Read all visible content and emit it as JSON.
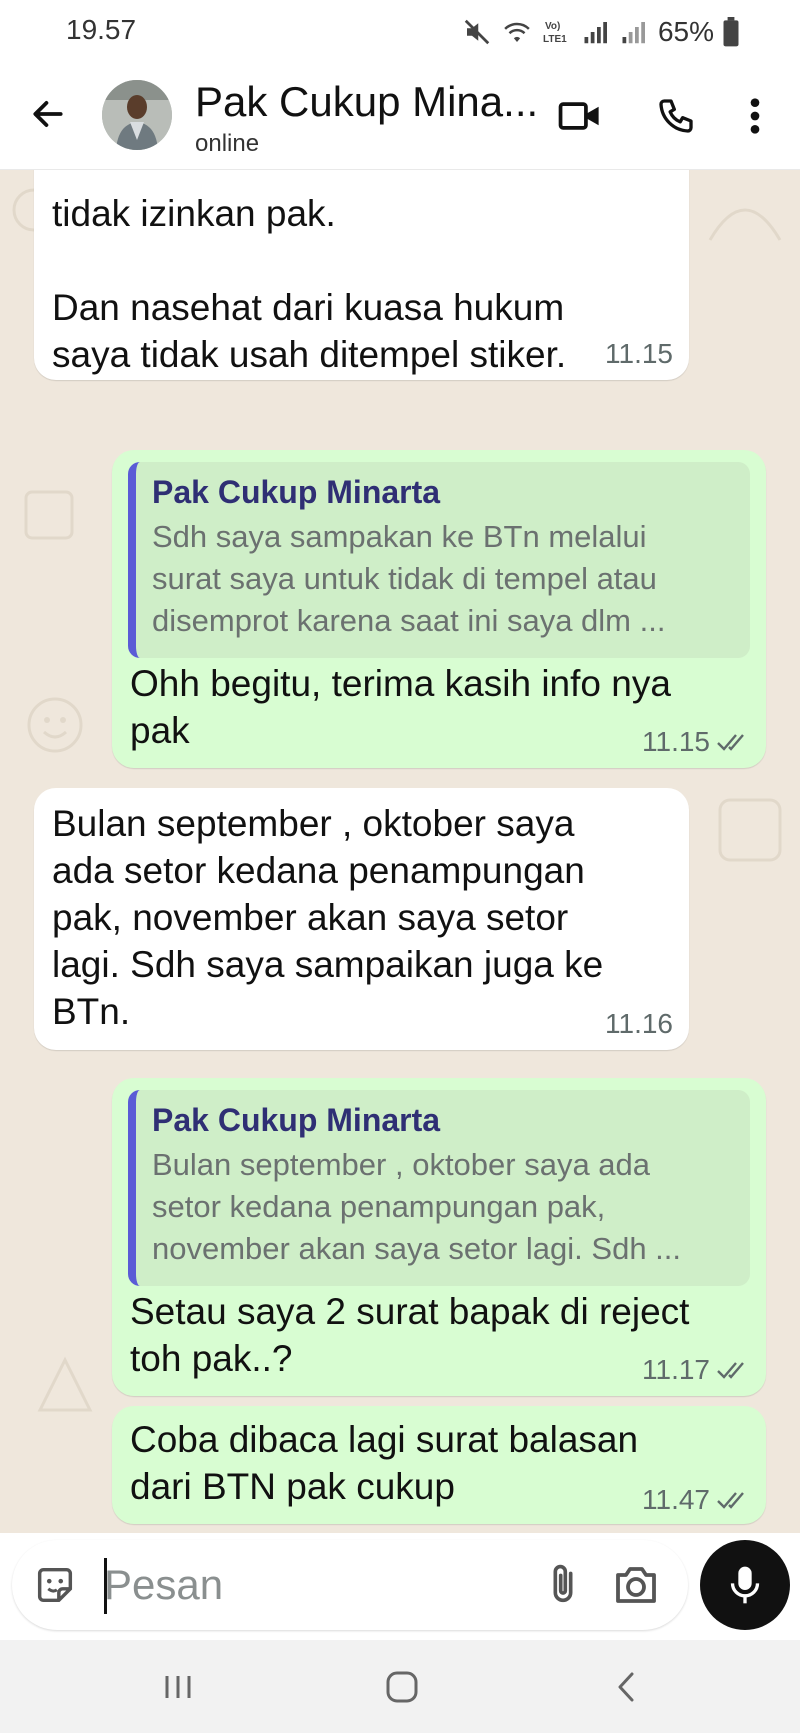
{
  "status_bar": {
    "time": "19.57",
    "battery": "65%",
    "icons": [
      "mute-icon",
      "wifi-icon",
      "volte-icon",
      "signal-icon",
      "signal-icon-2",
      "battery-icon"
    ],
    "volte_label": "Vo)\nLTE1"
  },
  "header": {
    "contact_name": "Pak Cukup Mina...",
    "status": "online",
    "icons": [
      "back-arrow-icon",
      "video-call-icon",
      "phone-icon",
      "more-vert-icon"
    ]
  },
  "colors": {
    "chat_bg": "#efe7dc",
    "incoming_bubble": "#ffffff",
    "outgoing_bubble": "#d8fdd2",
    "quote_bar": "#5b5bd6",
    "quote_author": "#2f2f74",
    "read_tick": "#5f6a6a"
  },
  "messages": [
    {
      "direction": "in",
      "text": "tidak izinkan pak.\n\nDan nasehat dari kuasa hukum\nsaya tidak usah ditempel stiker.",
      "time": "11.15"
    },
    {
      "direction": "out",
      "quote_author": "Pak Cukup Minarta",
      "quote_text": "Sdh saya sampakan ke BTn melalui\nsurat saya untuk tidak di tempel atau\ndisemprot karena saat ini saya dlm ...",
      "text": "Ohh begitu, terima kasih info nya\npak",
      "time": "11.15"
    },
    {
      "direction": "in",
      "text": "Bulan september , oktober saya\nada setor kedana penampungan\npak, november akan saya setor\nlagi. Sdh saya sampaikan juga ke\nBTn.",
      "time": "11.16"
    },
    {
      "direction": "out",
      "quote_author": "Pak Cukup Minarta",
      "quote_text": "Bulan september , oktober saya ada\nsetor kedana penampungan pak,\nnovember akan saya setor lagi. Sdh ...",
      "text": "Setau saya 2 surat bapak di reject\ntoh pak..?",
      "time": "11.17"
    },
    {
      "direction": "out",
      "text": "Coba dibaca lagi surat balasan\ndari BTN pak cukup",
      "time": "11.47"
    }
  ],
  "input": {
    "placeholder": "Pesan",
    "value": ""
  },
  "nav_bar": {
    "icons": [
      "recent-apps-icon",
      "home-icon",
      "back-icon"
    ]
  }
}
